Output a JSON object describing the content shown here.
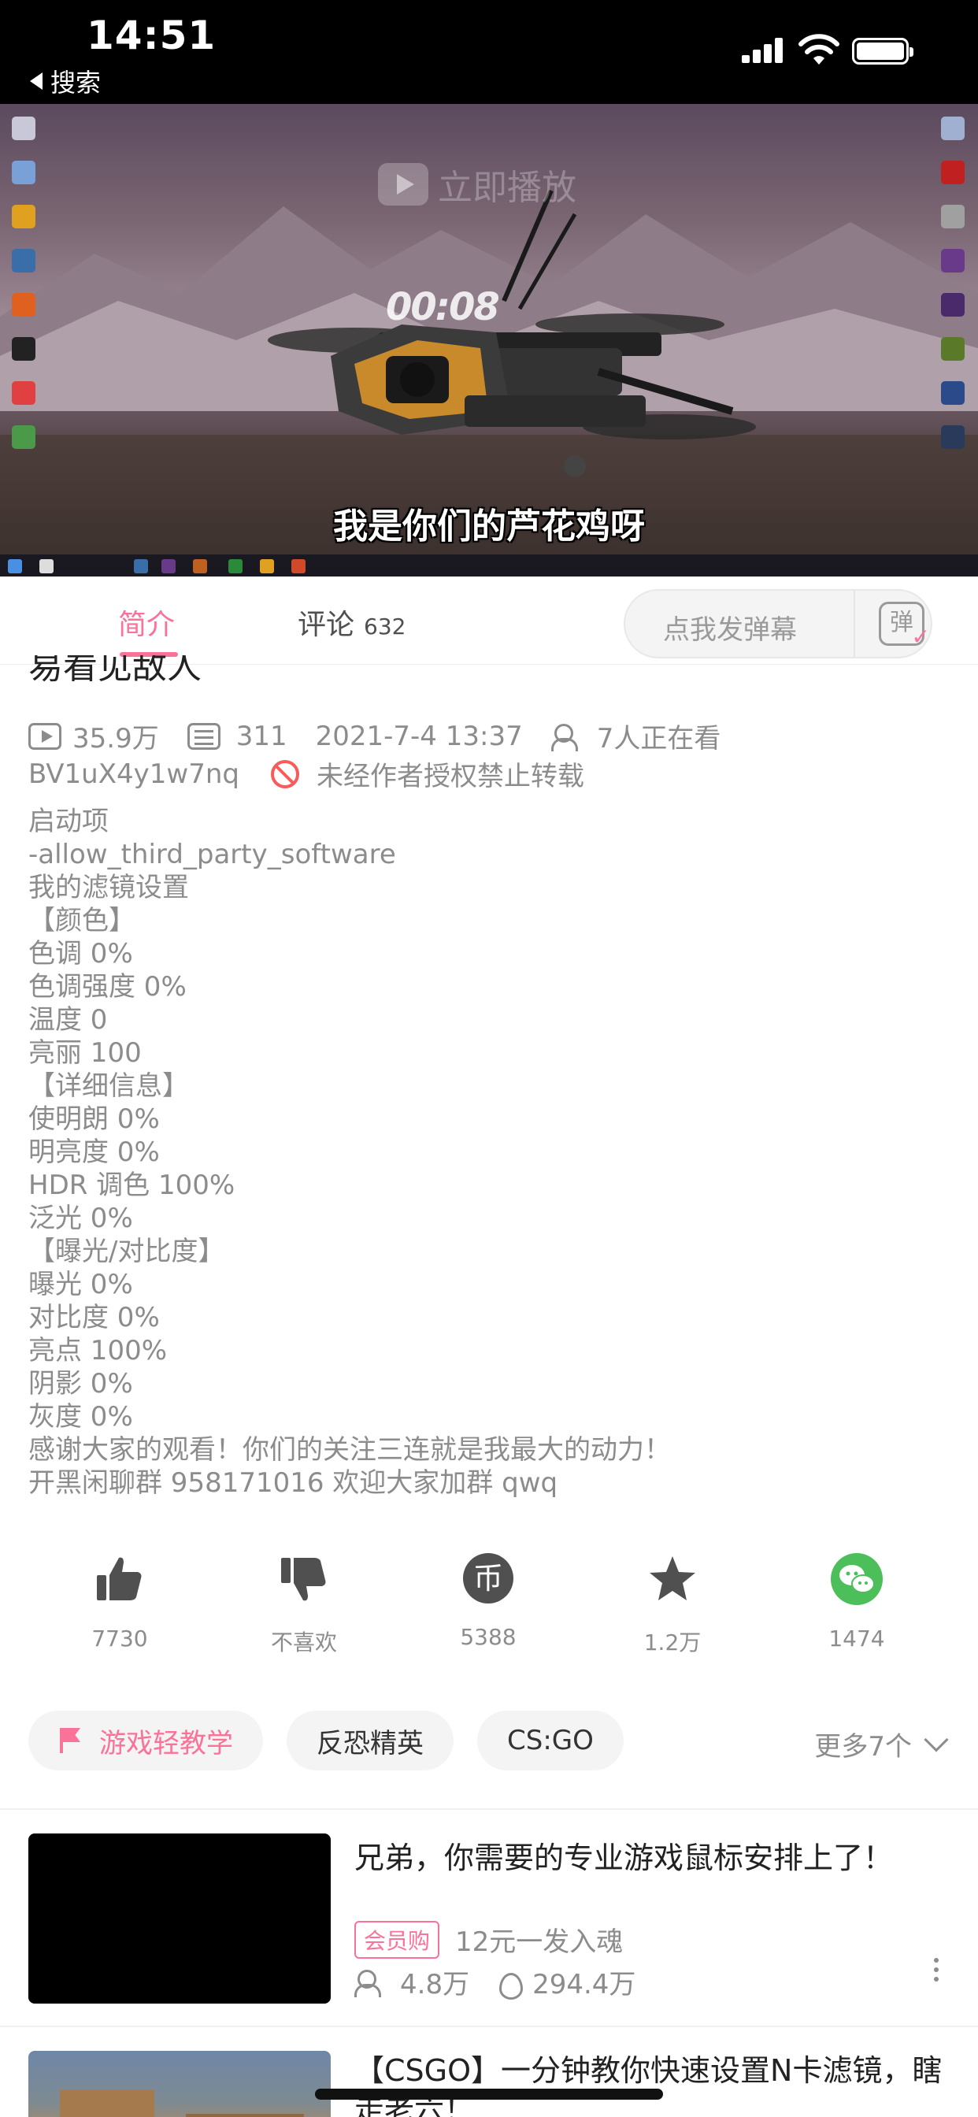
{
  "status_bar": {
    "time": "14:51",
    "back_label": "搜索",
    "icons": [
      "signal-icon",
      "wifi-icon",
      "battery-icon"
    ]
  },
  "video": {
    "watermark": "立即播放",
    "timer": "00:08",
    "subtitle": "我是你们的芦花鸡呀"
  },
  "tabs": {
    "intro_label": "简介",
    "comments_label": "评论",
    "comments_count": "632",
    "danmaku_placeholder": "点我发弹幕",
    "danmaku_icon_label": "弹"
  },
  "video_info": {
    "title_partial": "易看见敌人",
    "views": "35.9万",
    "danmaku_count": "311",
    "publish_time": "2021-7-4 13:37",
    "watching_now": "7人正在看",
    "bvid": "BV1uX4y1w7nq",
    "copyright_notice": "未经作者授权禁止转载"
  },
  "description_lines": [
    "启动项",
    "-allow_third_party_software",
    "我的滤镜设置",
    "【颜色】",
    "色调 0%",
    "色调强度 0%",
    "温度 0",
    "亮丽 100",
    "【详细信息】",
    "使明朗 0%",
    "明亮度 0%",
    "HDR 调色 100%",
    "泛光 0%",
    "【曝光/对比度】",
    "曝光 0%",
    "对比度 0%",
    "亮点 100%",
    "阴影 0%",
    "灰度 0%",
    "感谢大家的观看！你们的关注三连就是我最大的动力！",
    "开黑闲聊群 958171016 欢迎大家加群 qwq"
  ],
  "actions": [
    {
      "icon": "thumbs-up-icon",
      "label": "7730"
    },
    {
      "icon": "thumbs-down-icon",
      "label": "不喜欢"
    },
    {
      "icon": "coin-icon",
      "label": "5388"
    },
    {
      "icon": "star-icon",
      "label": "1.2万"
    },
    {
      "icon": "wechat-icon",
      "label": "1474"
    }
  ],
  "tags": {
    "items": [
      "游戏轻教学",
      "反恐精英",
      "CS:GO"
    ],
    "more_label": "更多7个"
  },
  "recommended": [
    {
      "title": "兄弟，你需要的专业游戏鼠标安排上了！",
      "badge": "会员购",
      "subtitle": "12元一发入魂",
      "stat1": "4.8万",
      "stat2": "294.4万"
    },
    {
      "title": "【CSGO】一分钟教你快速设置N卡滤镜，瞎走老六！"
    }
  ],
  "colors": {
    "accent": "#fb7299",
    "text_secondary": "#8c8c8c",
    "wechat_green": "#4cbf5b"
  }
}
